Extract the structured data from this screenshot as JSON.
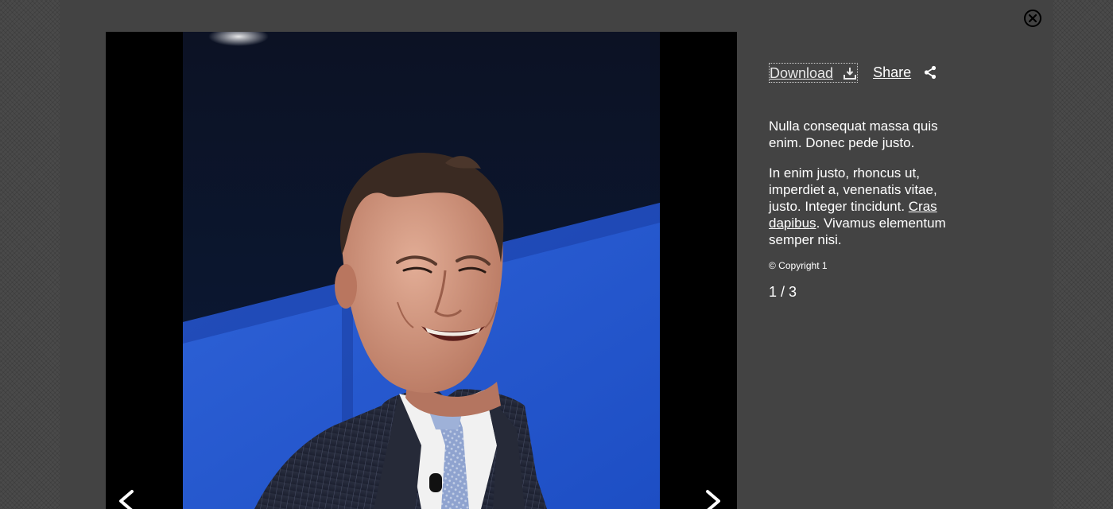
{
  "lightbox": {
    "close_icon": "close-circle-icon",
    "image_alt": "Smiling man in a pinstripe suit speaking on stage",
    "prev_icon": "chevron-left-icon",
    "next_icon": "chevron-right-icon"
  },
  "sidebar": {
    "download_label": "Download",
    "download_icon": "download-icon",
    "share_label": "Share",
    "share_icon": "share-icon",
    "paragraph1": "Nulla consequat massa quis enim. Donec pede justo.",
    "paragraph2_before": "In enim justo, rhoncus ut, imperdiet a, venenatis vitae, justo. Integer tincidunt. ",
    "paragraph2_link": "Cras dapibus",
    "paragraph2_after": ". Vivamus elementum semper nisi.",
    "copyright": "© Copyright 1",
    "counter": "1 / 3"
  },
  "colors": {
    "backdrop": "#4a4a4a",
    "modal": "#434343",
    "viewer": "#000000",
    "text": "#ffffff"
  }
}
